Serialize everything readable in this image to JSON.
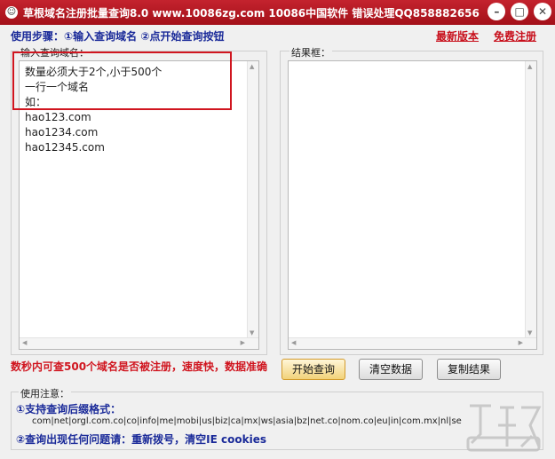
{
  "window": {
    "title": "草根域名注册批量查询8.0   www.10086zg.com   10086中国软件  错误处理QQ858882656",
    "icon_glyph": "☺",
    "minimize": "–",
    "maximize": "□",
    "close": "✕"
  },
  "header": {
    "steps": "使用步骤：①输入查询域名    ②点开始查询按钮",
    "latest_version": "最新版本",
    "free_register": "免费注册"
  },
  "input_panel": {
    "label": "输入查询域名：",
    "lines": [
      "数量必须大于2个,小于500个",
      "一行一个域名",
      "如：",
      "hao123.com",
      "hao1234.com",
      "hao12345.com"
    ]
  },
  "result_panel": {
    "label": "结果框："
  },
  "footer": {
    "promo": "数秒内可查500个域名是否被注册，速度快，数据准确",
    "start_query": "开始查询",
    "clear_data": "清空数据",
    "copy_result": "复制结果"
  },
  "notes": {
    "label": "使用注意：",
    "item1_title": "①支持查询后缀格式：",
    "suffixes": "com|net|orgl.com.co|co|info|me|mobi|us|biz|ca|mx|ws|asia|bz|net.co|nom.co|eu|in|com.mx|nl|se",
    "item2": "②查询出现任何问题请：重新拨号，清空IE cookies"
  },
  "colors": {
    "titlebar": "#b51a24",
    "accent_red": "#d0151f",
    "step_blue": "#1a2a99"
  }
}
